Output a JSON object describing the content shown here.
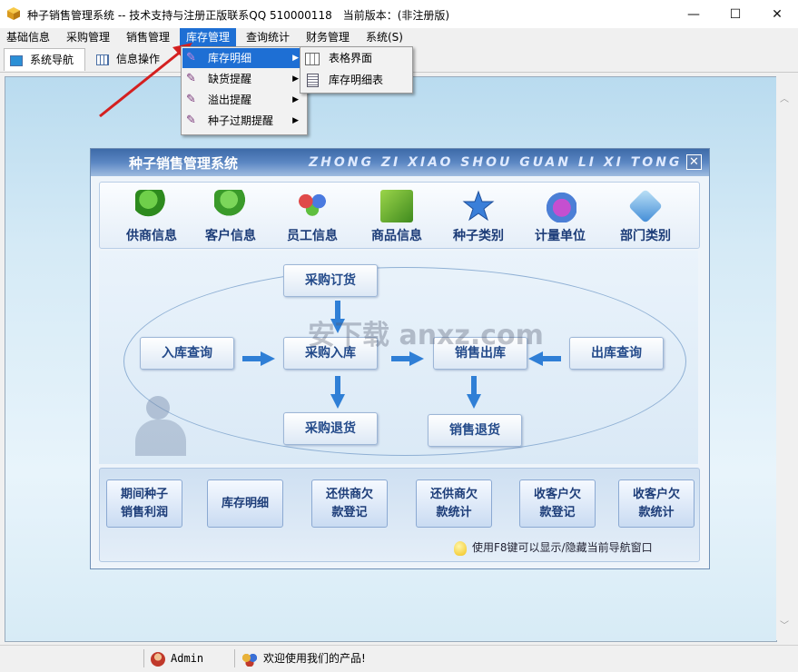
{
  "window": {
    "title": "种子销售管理系统 -- 技术支持与注册正版联系QQ 510000118　当前版本：(非注册版)",
    "controls": [
      "—",
      "☐",
      "✕"
    ]
  },
  "menubar": {
    "items": [
      "基础信息",
      "采购管理",
      "销售管理",
      "库存管理",
      "查询统计",
      "财务管理",
      "系统(S)"
    ],
    "active_index": 3
  },
  "tabs": {
    "nav": "系统导航",
    "info": "信息操作"
  },
  "dropdown": {
    "items": [
      "库存明细",
      "缺货提醒",
      "溢出提醒",
      "种子过期提醒"
    ],
    "highlighted_index": 0,
    "submenu": [
      "表格界面",
      "库存明细表"
    ]
  },
  "nav_window": {
    "title_cn": "种子销售管理系统",
    "title_en": "ZHONG ZI XIAO SHOU GUAN LI XI TONG",
    "close": "✕",
    "categories": [
      "供商信息",
      "客户信息",
      "员工信息",
      "商品信息",
      "种子类别",
      "计量单位",
      "部门类别"
    ],
    "flow": {
      "purchase_order": "采购订货",
      "stock_in_query": "入库查询",
      "purchase_in": "采购入库",
      "sales_out": "销售出库",
      "stock_out_query": "出库查询",
      "purchase_return": "采购退货",
      "sales_return": "销售退货"
    },
    "bottom_buttons": [
      [
        "期间种子",
        "销售利润"
      ],
      [
        "库存明细",
        ""
      ],
      [
        "还供商欠",
        "款登记"
      ],
      [
        "还供商欠",
        "款统计"
      ],
      [
        "收客户欠",
        "款登记"
      ],
      [
        "收客户欠",
        "款统计"
      ]
    ],
    "hint": "使用F8键可以显示/隐藏当前导航窗口"
  },
  "watermark": "安下载 anxz.com",
  "statusbar": {
    "user": "Admin",
    "message": "欢迎使用我们的产品!"
  },
  "colors": {
    "menu_highlight": "#1e6fd4",
    "nav_header": "#3d6aa8",
    "button_text": "#234a8a",
    "annotation_arrow": "#d42020"
  }
}
